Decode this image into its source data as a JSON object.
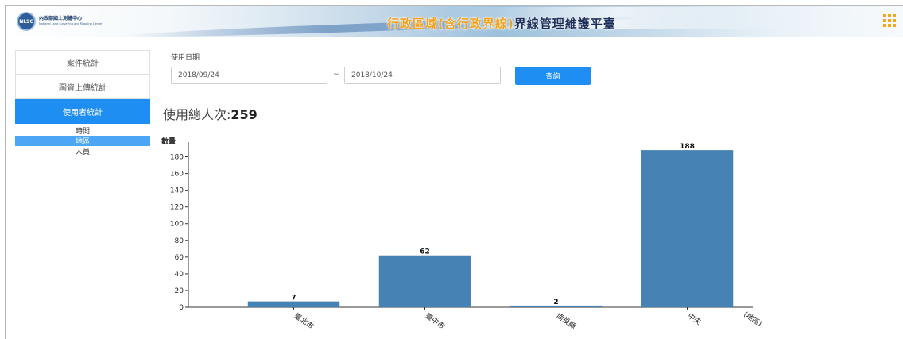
{
  "header": {
    "logo_badge": "NLSC",
    "logo_zh": "內政部國土測繪中心",
    "logo_en": "National Land Surveying and Mapping Center",
    "title_part1": "行政區域(含行政界線)",
    "title_part2": "界線管理維護平臺",
    "menu_icon": "grid-menu-icon"
  },
  "sidebar": {
    "items": [
      {
        "label": "案件統計",
        "active": false
      },
      {
        "label": "圖資上傳統計",
        "active": false
      },
      {
        "label": "使用者統計",
        "active": true
      }
    ],
    "subitems": [
      {
        "label": "時間",
        "active": false
      },
      {
        "label": "地區",
        "active": true
      },
      {
        "label": "人員",
        "active": false
      }
    ]
  },
  "filter": {
    "label": "使用日期",
    "from": "2018/09/24",
    "separator": "~",
    "to": "2018/10/24",
    "query_button": "查詢"
  },
  "summary": {
    "label": "使用總人次:",
    "value": "259"
  },
  "colors": {
    "accent": "#1e8ef2",
    "bar": "#4682b4",
    "title_orange": "#f5a21b",
    "title_navy": "#1b2f5a"
  },
  "chart_data": {
    "type": "bar",
    "title": "",
    "ylabel": "數量",
    "xlabel": "(地區)",
    "categories": [
      "臺北市",
      "臺中市",
      "南投縣",
      "中央"
    ],
    "values": [
      7,
      62,
      2,
      188
    ],
    "ylim": [
      0,
      190
    ],
    "yticks": [
      0,
      20,
      40,
      60,
      80,
      100,
      120,
      140,
      160,
      180
    ],
    "grid": false,
    "legend": "none"
  }
}
